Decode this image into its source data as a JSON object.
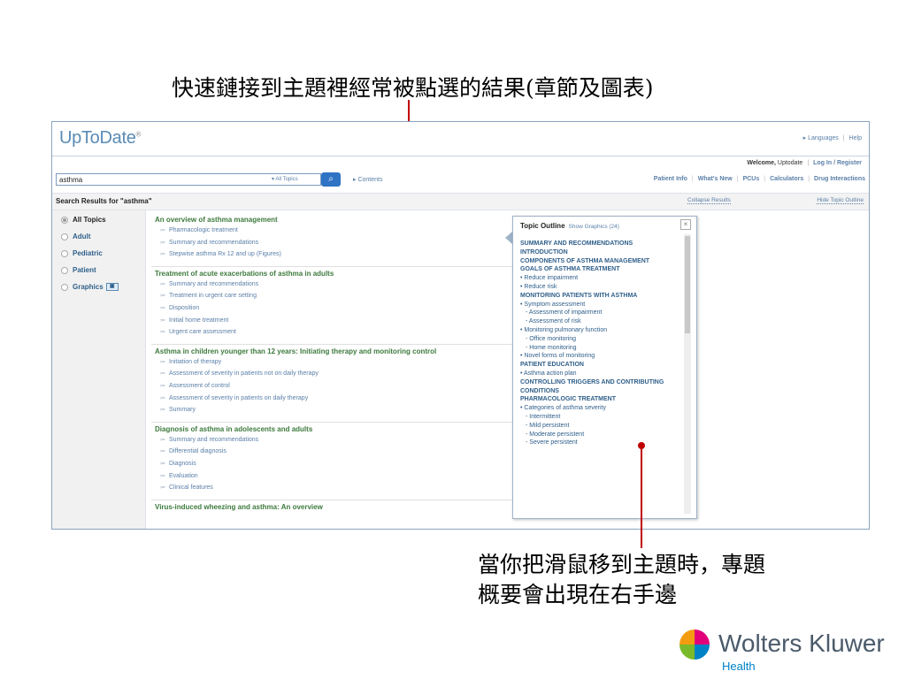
{
  "captions": {
    "top": "快速鏈接到主題裡經常被點選的結果(章節及圖表)",
    "bottom_line1": "當你把滑鼠移到主題時，專題",
    "bottom_line2": "概要會出現在右手邊"
  },
  "header": {
    "logo": "UpToDate",
    "logo_mark": "®",
    "languages": "Languages",
    "help": "Help",
    "welcome": "Welcome,",
    "welcome_user": "Uptodate",
    "login": "Log In / Register"
  },
  "search": {
    "value": "asthma",
    "scope": "All Topics",
    "contents": "Contents",
    "nav": [
      "Patient Info",
      "What's New",
      "PCUs",
      "Calculators",
      "Drug Interactions"
    ]
  },
  "results_bar": {
    "label": "Search Results for ",
    "query": "\"asthma\"",
    "collapse": "Collapse Results",
    "hide_outline": "Hide Topic Outline"
  },
  "sidebar": {
    "items": [
      {
        "label": "All Topics"
      },
      {
        "label": "Adult"
      },
      {
        "label": "Pediatric"
      },
      {
        "label": "Patient"
      },
      {
        "label": "Graphics"
      }
    ]
  },
  "results": [
    {
      "title": "An overview of asthma management",
      "subs": [
        "Pharmacologic treatment",
        "Summary and recommendations",
        "Stepwise asthma Rx 12 and up (Figures)"
      ]
    },
    {
      "title": "Treatment of acute exacerbations of asthma in adults",
      "subs": [
        "Summary and recommendations",
        "Treatment in urgent care setting",
        "Disposition",
        "Initial home treatment",
        "Urgent care assessment"
      ]
    },
    {
      "title": "Asthma in children younger than 12 years: Initiating therapy and monitoring control",
      "subs": [
        "Initiation of therapy",
        "Assessment of severity in patients not on daily therapy",
        "Assessment of control",
        "Assessment of severity in patients on daily therapy",
        "Summary"
      ]
    },
    {
      "title": "Diagnosis of asthma in adolescents and adults",
      "subs": [
        "Summary and recommendations",
        "Differential diagnosis",
        "Diagnosis",
        "Evaluation",
        "Clinical features"
      ]
    },
    {
      "title": "Virus-induced wheezing and asthma: An overview",
      "subs": []
    }
  ],
  "outline": {
    "title": "Topic Outline",
    "show_graphics": "Show Graphics (24)",
    "close": "×",
    "items": [
      {
        "text": "SUMMARY AND RECOMMENDATIONS",
        "kind": "head"
      },
      {
        "text": "INTRODUCTION",
        "kind": "head"
      },
      {
        "text": "COMPONENTS OF ASTHMA MANAGEMENT",
        "kind": "head"
      },
      {
        "text": "GOALS OF ASTHMA TREATMENT",
        "kind": "head"
      },
      {
        "text": "• Reduce impairment",
        "kind": "l1"
      },
      {
        "text": "• Reduce risk",
        "kind": "l1"
      },
      {
        "text": "MONITORING PATIENTS WITH ASTHMA",
        "kind": "head"
      },
      {
        "text": "• Symptom assessment",
        "kind": "l1"
      },
      {
        "text": "- Assessment of impairment",
        "kind": "l2"
      },
      {
        "text": "- Assessment of risk",
        "kind": "l2"
      },
      {
        "text": "• Monitoring pulmonary function",
        "kind": "l1"
      },
      {
        "text": "- Office monitoring",
        "kind": "l2"
      },
      {
        "text": "- Home monitoring",
        "kind": "l2"
      },
      {
        "text": "• Novel forms of monitoring",
        "kind": "l1"
      },
      {
        "text": "PATIENT EDUCATION",
        "kind": "head"
      },
      {
        "text": "• Asthma action plan",
        "kind": "l1"
      },
      {
        "text": "CONTROLLING TRIGGERS AND CONTRIBUTING",
        "kind": "head"
      },
      {
        "text": "CONDITIONS",
        "kind": "head"
      },
      {
        "text": "PHARMACOLOGIC TREATMENT",
        "kind": "head"
      },
      {
        "text": "• Categories of asthma severity",
        "kind": "l1"
      },
      {
        "text": "- Intermittent",
        "kind": "l2"
      },
      {
        "text": "- Mild persistent",
        "kind": "l2"
      },
      {
        "text": "- Moderate persistent",
        "kind": "l2"
      },
      {
        "text": "- Severe persistent",
        "kind": "l2"
      }
    ]
  },
  "brand": {
    "name": "Wolters Kluwer",
    "sub": "Health"
  },
  "colors": {
    "accent": "#c00000",
    "link": "#5a7fa8",
    "title_green": "#3d7a3d"
  }
}
